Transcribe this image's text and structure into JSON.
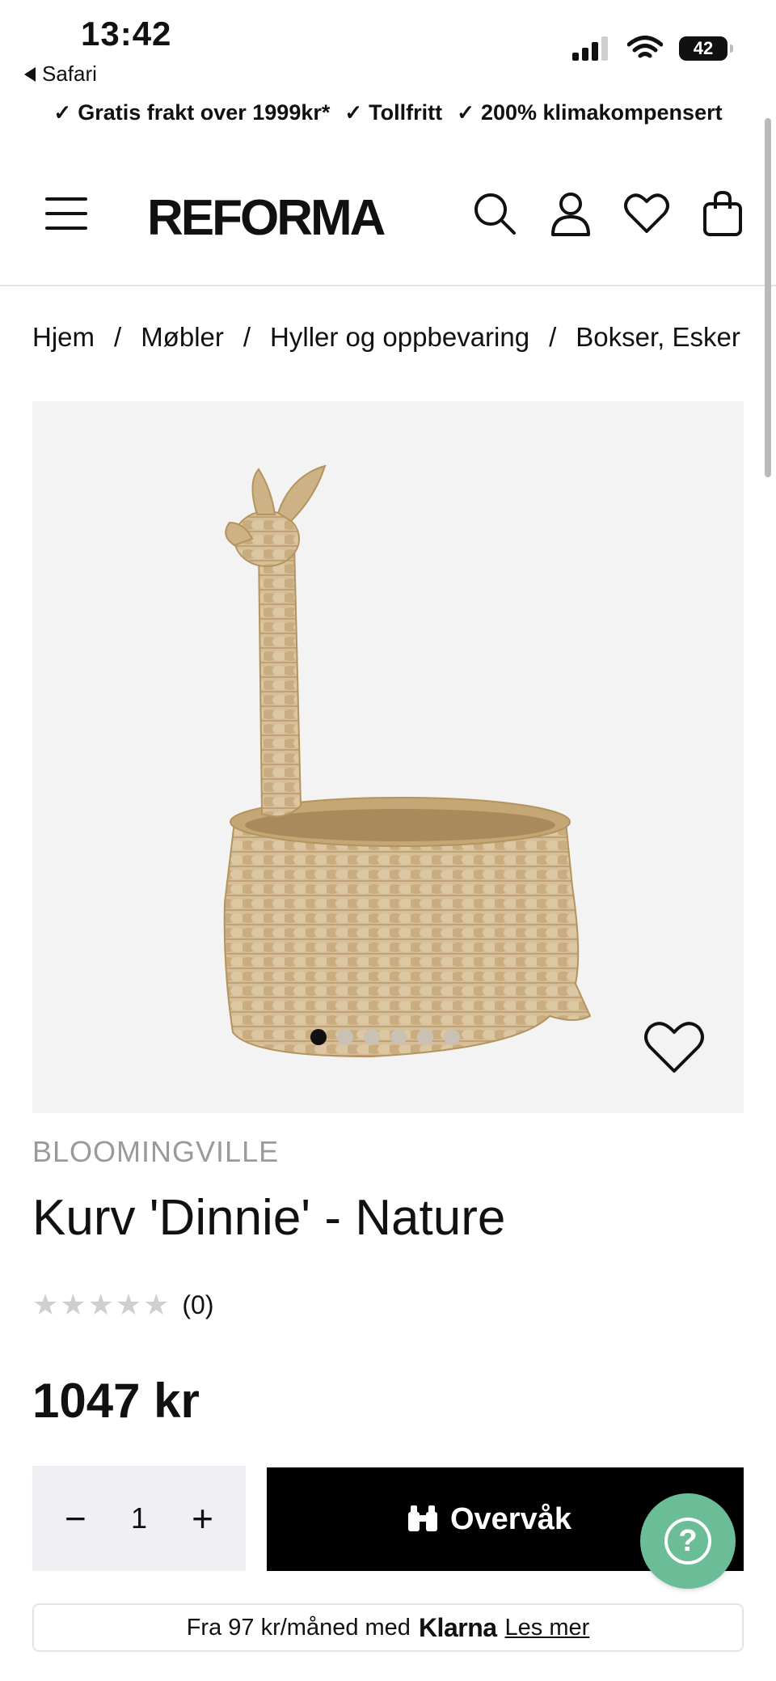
{
  "status_bar": {
    "time": "13:42",
    "back_app": "Safari",
    "battery": "42"
  },
  "usp": [
    {
      "label": "Gratis frakt over 1999kr*"
    },
    {
      "label": "Tollfritt"
    },
    {
      "label": "200% klimakompensert"
    }
  ],
  "header": {
    "logo": "REFORMA"
  },
  "breadcrumb": [
    "Hjem",
    "Møbler",
    "Hyller og oppbevaring",
    "Bokser, Esker"
  ],
  "gallery": {
    "slides": 6,
    "active_slide": 1
  },
  "product": {
    "brand": "BLOOMINGVILLE",
    "title": "Kurv 'Dinnie' - Nature",
    "stars": "★★★★★",
    "rating_count": "(0)",
    "price": "1047 kr"
  },
  "actions": {
    "minus": "−",
    "quantity": "1",
    "plus": "+",
    "watch_label": "Overvåk",
    "help": "?"
  },
  "klarna": {
    "prefix": "Fra 97 kr/måned med",
    "logo": "Klarna",
    "link": "Les mer"
  },
  "colors": {
    "accent_help": "#6bbd98",
    "button_black": "#000000",
    "brand_grey": "#9a9a9a"
  }
}
